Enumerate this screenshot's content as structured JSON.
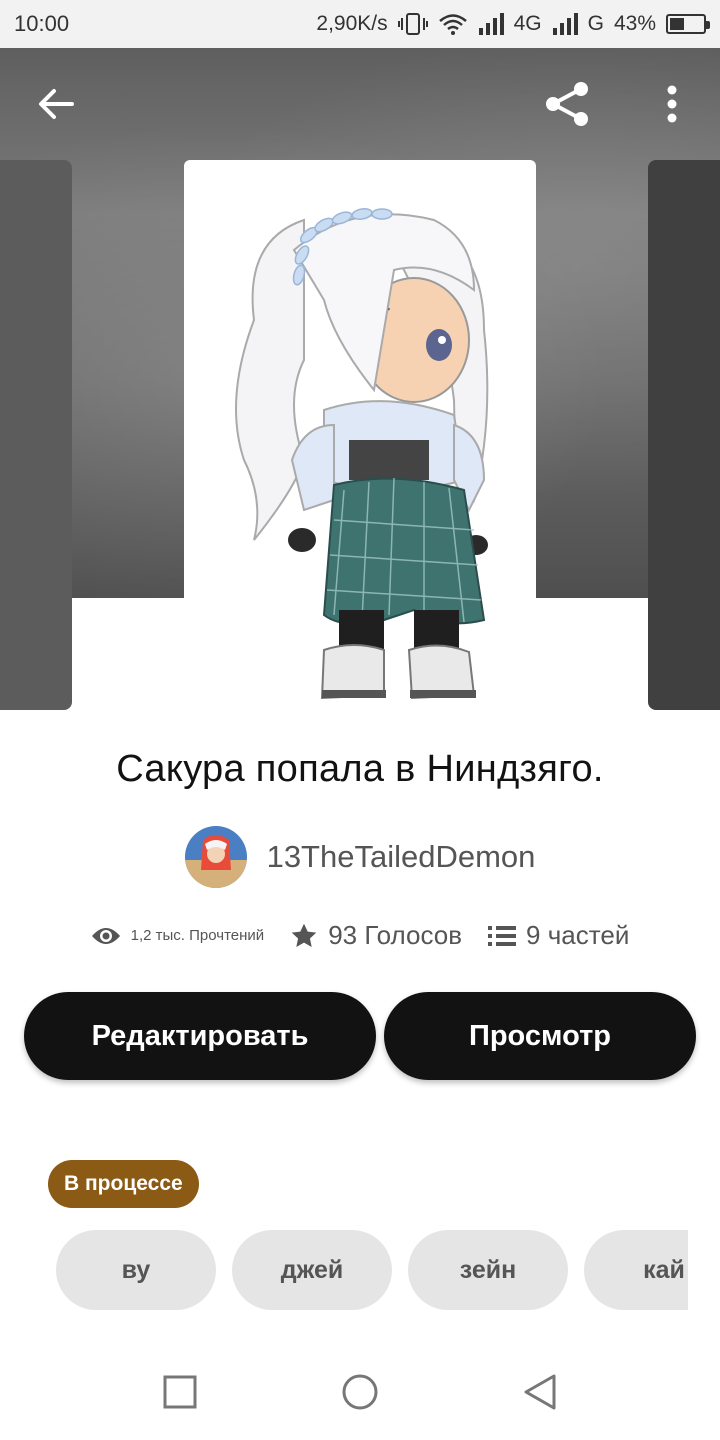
{
  "status_bar": {
    "time": "10:00",
    "net_speed": "2,90K/s",
    "network1": "4G",
    "network2": "G",
    "battery": "43%",
    "battery_level": 0.43
  },
  "header": {
    "back_icon": "arrow-left-icon",
    "share_icon": "share-icon",
    "more_icon": "more-vertical-icon"
  },
  "story": {
    "title": "Сакура попала в Ниндзяго.",
    "author": "13TheTailedDemon"
  },
  "stats": {
    "reads": "1,2 тыс. Прочтений",
    "votes": "93 Голосов",
    "parts": "9 частей"
  },
  "actions": {
    "edit_label": "Редактировать",
    "view_label": "Просмотр"
  },
  "status_badge": "В процессе",
  "tags": [
    "ву",
    "джей",
    "зейн",
    "кай"
  ],
  "colors": {
    "button_bg": "#121212",
    "badge_bg": "#8b5a14",
    "tag_bg": "#e6e5e6"
  }
}
